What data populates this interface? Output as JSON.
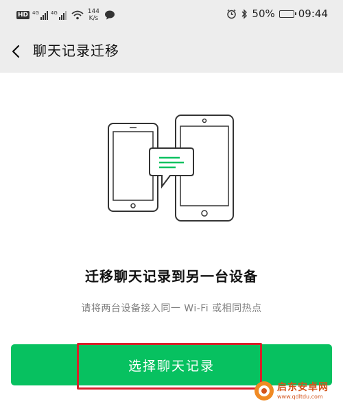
{
  "status_bar": {
    "hd_badge": "HD",
    "signal1_label": "4G",
    "signal2_label": "4G",
    "speed_value": "144",
    "speed_unit": "K/s",
    "battery_percent": "50%",
    "battery_level": 0.5,
    "time": "09:44"
  },
  "nav": {
    "title": "聊天记录迁移"
  },
  "main": {
    "headline": "迁移聊天记录到另一台设备",
    "subtext": "请将两台设备接入同一 Wi-Fi 或相同热点",
    "button_label": "选择聊天记录"
  },
  "watermark": {
    "text": "启东安卓网",
    "url": "www.qdltdu.com"
  },
  "colors": {
    "accent": "#07c160",
    "highlight": "#d7202a",
    "header_bg": "#ededed"
  }
}
